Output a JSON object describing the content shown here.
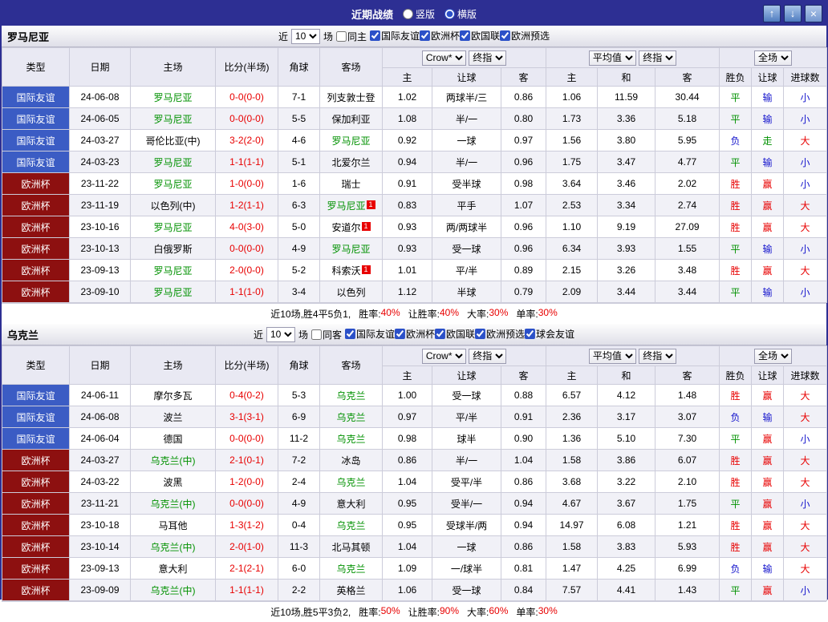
{
  "colors": {
    "titlebar_bg": "#2d2f93",
    "type_friendly_bg": "#3b5cc4",
    "type_eurocup_bg": "#8d1010",
    "team_green": "#009100",
    "score_red": "#e80000",
    "result_win": "#e80000",
    "result_draw": "#009100",
    "result_lose": "#1414cc"
  },
  "titlebar": {
    "title": "近期战绩",
    "layout_options": [
      {
        "label": "竖版",
        "selected": false
      },
      {
        "label": "横版",
        "selected": true
      }
    ],
    "up_label": "↑",
    "down_label": "↓",
    "close_label": "×"
  },
  "table_header": {
    "type": "类型",
    "date": "日期",
    "home": "主场",
    "score": "比分(半场)",
    "corners": "角球",
    "away": "客场",
    "bookmaker": "Crow*",
    "final_odds": "终指",
    "average": "平均值",
    "final_odds2": "终指",
    "fulltime": "全场",
    "sub_home": "主",
    "sub_handicap": "让球",
    "sub_away": "客",
    "sub_avg_home": "主",
    "sub_avg_draw": "和",
    "sub_avg_away": "客",
    "sub_result": "胜负",
    "sub_handicap_result": "让球",
    "sub_goals": "进球数"
  },
  "sections": [
    {
      "team": "罗马尼亚",
      "filter": {
        "near": "近",
        "count": "10",
        "games": "场",
        "same": "同主",
        "leagues": [
          "国际友谊",
          "欧洲杯",
          "欧国联",
          "欧洲预选"
        ]
      },
      "rows": [
        {
          "type": "国际友谊",
          "date": "24-06-08",
          "home": "罗马尼亚",
          "home_focus": true,
          "score": "0-0(0-0)",
          "corners": "7-1",
          "away": "列支敦士登",
          "odds_home": "1.02",
          "handicap": "两球半/三",
          "odds_away": "0.86",
          "avg_home": "1.06",
          "avg_draw": "11.59",
          "avg_away": "30.44",
          "result": "平",
          "handicap_result": "输",
          "goals_result": "小"
        },
        {
          "type": "国际友谊",
          "date": "24-06-05",
          "home": "罗马尼亚",
          "home_focus": true,
          "score": "0-0(0-0)",
          "corners": "5-5",
          "away": "保加利亚",
          "odds_home": "1.08",
          "handicap": "半/一",
          "odds_away": "0.80",
          "avg_home": "1.73",
          "avg_draw": "3.36",
          "avg_away": "5.18",
          "result": "平",
          "handicap_result": "输",
          "goals_result": "小"
        },
        {
          "type": "国际友谊",
          "date": "24-03-27",
          "home": "哥伦比亚(中)",
          "score": "3-2(2-0)",
          "corners": "4-6",
          "away": "罗马尼亚",
          "away_focus": true,
          "odds_home": "0.92",
          "handicap": "一球",
          "odds_away": "0.97",
          "avg_home": "1.56",
          "avg_draw": "3.80",
          "avg_away": "5.95",
          "result": "负",
          "handicap_result": "走",
          "goals_result": "大"
        },
        {
          "type": "国际友谊",
          "date": "24-03-23",
          "home": "罗马尼亚",
          "home_focus": true,
          "score": "1-1(1-1)",
          "corners": "5-1",
          "away": "北爱尔兰",
          "odds_home": "0.94",
          "handicap": "半/一",
          "odds_away": "0.96",
          "avg_home": "1.75",
          "avg_draw": "3.47",
          "avg_away": "4.77",
          "result": "平",
          "handicap_result": "输",
          "goals_result": "小"
        },
        {
          "type": "欧洲杯",
          "date": "23-11-22",
          "home": "罗马尼亚",
          "home_focus": true,
          "score": "1-0(0-0)",
          "corners": "1-6",
          "away": "瑞士",
          "odds_home": "0.91",
          "handicap": "受半球",
          "odds_away": "0.98",
          "avg_home": "3.64",
          "avg_draw": "3.46",
          "avg_away": "2.02",
          "result": "胜",
          "handicap_result": "赢",
          "goals_result": "小"
        },
        {
          "type": "欧洲杯",
          "date": "23-11-19",
          "home": "以色列(中)",
          "score": "1-2(1-1)",
          "corners": "6-3",
          "away": "罗马尼亚",
          "away_focus": true,
          "away_card": "1",
          "odds_home": "0.83",
          "handicap": "平手",
          "odds_away": "1.07",
          "avg_home": "2.53",
          "avg_draw": "3.34",
          "avg_away": "2.74",
          "result": "胜",
          "handicap_result": "赢",
          "goals_result": "大"
        },
        {
          "type": "欧洲杯",
          "date": "23-10-16",
          "home": "罗马尼亚",
          "home_focus": true,
          "score": "4-0(3-0)",
          "corners": "5-0",
          "away": "安道尔",
          "away_card": "1",
          "odds_home": "0.93",
          "handicap": "两/两球半",
          "odds_away": "0.96",
          "avg_home": "1.10",
          "avg_draw": "9.19",
          "avg_away": "27.09",
          "result": "胜",
          "handicap_result": "赢",
          "goals_result": "大"
        },
        {
          "type": "欧洲杯",
          "date": "23-10-13",
          "home": "白俄罗斯",
          "score": "0-0(0-0)",
          "corners": "4-9",
          "away": "罗马尼亚",
          "away_focus": true,
          "odds_home": "0.93",
          "handicap": "受一球",
          "odds_away": "0.96",
          "avg_home": "6.34",
          "avg_draw": "3.93",
          "avg_away": "1.55",
          "result": "平",
          "handicap_result": "输",
          "goals_result": "小"
        },
        {
          "type": "欧洲杯",
          "date": "23-09-13",
          "home": "罗马尼亚",
          "home_focus": true,
          "score": "2-0(0-0)",
          "corners": "5-2",
          "away": "科索沃",
          "away_card": "1",
          "odds_home": "1.01",
          "handicap": "平/半",
          "odds_away": "0.89",
          "avg_home": "2.15",
          "avg_draw": "3.26",
          "avg_away": "3.48",
          "result": "胜",
          "handicap_result": "赢",
          "goals_result": "大"
        },
        {
          "type": "欧洲杯",
          "date": "23-09-10",
          "home": "罗马尼亚",
          "home_focus": true,
          "score": "1-1(1-0)",
          "corners": "3-4",
          "away": "以色列",
          "odds_home": "1.12",
          "handicap": "半球",
          "odds_away": "0.79",
          "avg_home": "2.09",
          "avg_draw": "3.44",
          "avg_away": "3.44",
          "result": "平",
          "handicap_result": "输",
          "goals_result": "小"
        }
      ],
      "summary": {
        "prefix": "近10场,胜4平5负1,",
        "stats": [
          {
            "label": "胜率:",
            "value": "40%"
          },
          {
            "label": "让胜率:",
            "value": "40%"
          },
          {
            "label": "大率:",
            "value": "30%"
          },
          {
            "label": "单率:",
            "value": "30%"
          }
        ]
      }
    },
    {
      "team": "乌克兰",
      "filter": {
        "near": "近",
        "count": "10",
        "games": "场",
        "same": "同客",
        "leagues": [
          "国际友谊",
          "欧洲杯",
          "欧国联",
          "欧洲预选",
          "球会友谊"
        ]
      },
      "rows": [
        {
          "type": "国际友谊",
          "date": "24-06-11",
          "home": "摩尔多瓦",
          "score": "0-4(0-2)",
          "corners": "5-3",
          "away": "乌克兰",
          "away_focus": true,
          "odds_home": "1.00",
          "handicap": "受一球",
          "odds_away": "0.88",
          "avg_home": "6.57",
          "avg_draw": "4.12",
          "avg_away": "1.48",
          "result": "胜",
          "handicap_result": "赢",
          "goals_result": "大"
        },
        {
          "type": "国际友谊",
          "date": "24-06-08",
          "home": "波兰",
          "score": "3-1(3-1)",
          "corners": "6-9",
          "away": "乌克兰",
          "away_focus": true,
          "odds_home": "0.97",
          "handicap": "平/半",
          "odds_away": "0.91",
          "avg_home": "2.36",
          "avg_draw": "3.17",
          "avg_away": "3.07",
          "result": "负",
          "handicap_result": "输",
          "goals_result": "大"
        },
        {
          "type": "国际友谊",
          "date": "24-06-04",
          "home": "德国",
          "score": "0-0(0-0)",
          "corners": "11-2",
          "away": "乌克兰",
          "away_focus": true,
          "odds_home": "0.98",
          "handicap": "球半",
          "odds_away": "0.90",
          "avg_home": "1.36",
          "avg_draw": "5.10",
          "avg_away": "7.30",
          "result": "平",
          "handicap_result": "赢",
          "goals_result": "小"
        },
        {
          "type": "欧洲杯",
          "date": "24-03-27",
          "home": "乌克兰(中)",
          "home_focus": true,
          "score": "2-1(0-1)",
          "corners": "7-2",
          "away": "冰岛",
          "odds_home": "0.86",
          "handicap": "半/一",
          "odds_away": "1.04",
          "avg_home": "1.58",
          "avg_draw": "3.86",
          "avg_away": "6.07",
          "result": "胜",
          "handicap_result": "赢",
          "goals_result": "大"
        },
        {
          "type": "欧洲杯",
          "date": "24-03-22",
          "home": "波黑",
          "score": "1-2(0-0)",
          "corners": "2-4",
          "away": "乌克兰",
          "away_focus": true,
          "odds_home": "1.04",
          "handicap": "受平/半",
          "odds_away": "0.86",
          "avg_home": "3.68",
          "avg_draw": "3.22",
          "avg_away": "2.10",
          "result": "胜",
          "handicap_result": "赢",
          "goals_result": "大"
        },
        {
          "type": "欧洲杯",
          "date": "23-11-21",
          "home": "乌克兰(中)",
          "home_focus": true,
          "score": "0-0(0-0)",
          "corners": "4-9",
          "away": "意大利",
          "odds_home": "0.95",
          "handicap": "受半/一",
          "odds_away": "0.94",
          "avg_home": "4.67",
          "avg_draw": "3.67",
          "avg_away": "1.75",
          "result": "平",
          "handicap_result": "赢",
          "goals_result": "小"
        },
        {
          "type": "欧洲杯",
          "date": "23-10-18",
          "home": "马耳他",
          "score": "1-3(1-2)",
          "corners": "0-4",
          "away": "乌克兰",
          "away_focus": true,
          "odds_home": "0.95",
          "handicap": "受球半/两",
          "odds_away": "0.94",
          "avg_home": "14.97",
          "avg_draw": "6.08",
          "avg_away": "1.21",
          "result": "胜",
          "handicap_result": "赢",
          "goals_result": "大"
        },
        {
          "type": "欧洲杯",
          "date": "23-10-14",
          "home": "乌克兰(中)",
          "home_focus": true,
          "score": "2-0(1-0)",
          "corners": "11-3",
          "away": "北马其顿",
          "odds_home": "1.04",
          "handicap": "一球",
          "odds_away": "0.86",
          "avg_home": "1.58",
          "avg_draw": "3.83",
          "avg_away": "5.93",
          "result": "胜",
          "handicap_result": "赢",
          "goals_result": "大"
        },
        {
          "type": "欧洲杯",
          "date": "23-09-13",
          "home": "意大利",
          "score": "2-1(2-1)",
          "corners": "6-0",
          "away": "乌克兰",
          "away_focus": true,
          "odds_home": "1.09",
          "handicap": "一/球半",
          "odds_away": "0.81",
          "avg_home": "1.47",
          "avg_draw": "4.25",
          "avg_away": "6.99",
          "result": "负",
          "handicap_result": "输",
          "goals_result": "大"
        },
        {
          "type": "欧洲杯",
          "date": "23-09-09",
          "home": "乌克兰(中)",
          "home_focus": true,
          "score": "1-1(1-1)",
          "corners": "2-2",
          "away": "英格兰",
          "odds_home": "1.06",
          "handicap": "受一球",
          "odds_away": "0.84",
          "avg_home": "7.57",
          "avg_draw": "4.41",
          "avg_away": "1.43",
          "result": "平",
          "handicap_result": "赢",
          "goals_result": "小"
        }
      ],
      "summary": {
        "prefix": "近10场,胜5平3负2,",
        "stats": [
          {
            "label": "胜率:",
            "value": "50%"
          },
          {
            "label": "让胜率:",
            "value": "90%"
          },
          {
            "label": "大率:",
            "value": "60%"
          },
          {
            "label": "单率:",
            "value": "30%"
          }
        ]
      }
    }
  ]
}
